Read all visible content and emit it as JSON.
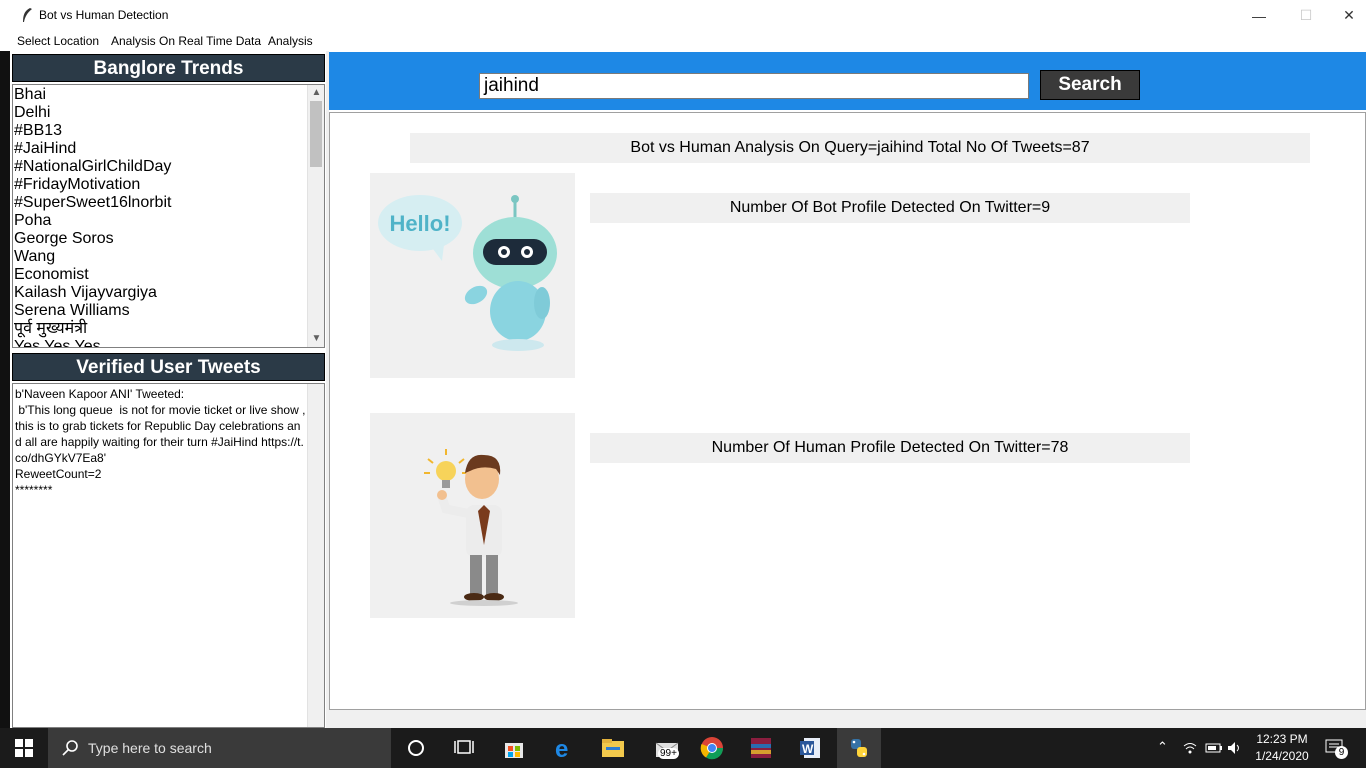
{
  "window": {
    "title": "Bot vs Human Detection",
    "minimize": "—",
    "maximize": "☐",
    "close": "✕"
  },
  "menu": {
    "items": [
      "Select Location",
      "Analysis On Real Time Data",
      "Analysis"
    ]
  },
  "trends": {
    "heading": "Banglore Trends",
    "items": [
      "Bhai",
      "Delhi",
      "#BB13",
      "#JaiHind",
      "#NationalGirlChildDay",
      "#FridayMotivation",
      "#SuperSweet16lnorbit",
      "Poha",
      "George Soros",
      "Wang",
      "Economist",
      "Kailash Vijayvargiya",
      "Serena Williams",
      "पूर्व मुख्यमंत्री",
      "Yes Yes Yes"
    ]
  },
  "verified": {
    "heading": "Verified User Tweets",
    "text": "b'Naveen Kapoor ANI' Tweeted:\n b'This long queue  is not for movie ticket or live show , this is to grab tickets for Republic Day celebrations and all are happily waiting for their turn #JaiHind https://t.co/dhGYkV7Ea8'\nReweetCount=2\n********"
  },
  "search": {
    "value": "jaihind",
    "button_label": "Search"
  },
  "analysis": {
    "title": "Bot vs Human Analysis On Query=jaihind Total No Of Tweets=87",
    "bot_count": "Number Of Bot Profile Detected On Twitter=9",
    "human_count": "Number Of Human Profile Detected On Twitter=78",
    "bot_bubble": "Hello!"
  },
  "taskbar": {
    "search_placeholder": "Type here to search",
    "mail_badge": "99+",
    "time": "12:23 PM",
    "date": "1/24/2020",
    "notifications": "9"
  },
  "colors": {
    "header_dark": "#2b3a47",
    "search_bar": "#1e88e5",
    "button_dark": "#3a3a3a",
    "taskbar": "#1b1b1b"
  }
}
